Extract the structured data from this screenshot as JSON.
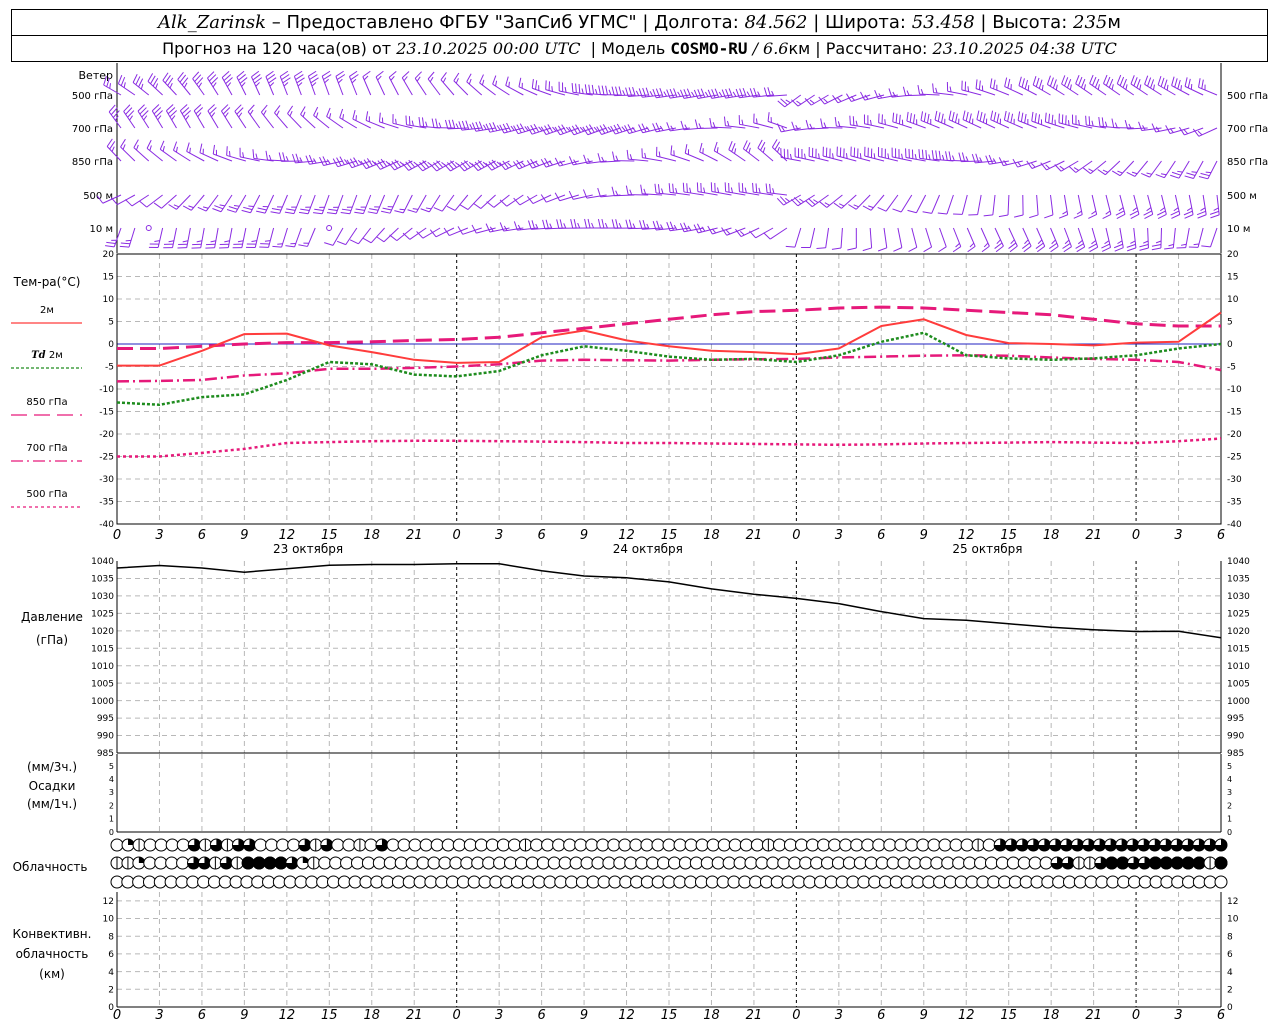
{
  "header": {
    "station": "Alk_Zarinsk",
    "sep": " – ",
    "provider": "Предоставлено ФГБУ \"ЗапСиб УГМС\"",
    "lon_label": "Долгота:",
    "lon": "84.562",
    "lat_label": "Широта:",
    "lat": "53.458",
    "alt_label": "Высота:",
    "alt": "235",
    "alt_unit": "м",
    "forecast_label": "Прогноз на 120 часа(ов) от",
    "forecast_from": "23.10.2025 00:00 UTC",
    "model_label": "Модель",
    "model": "COSMO-RU",
    "resolution": "/ 6.6",
    "res_unit": "км",
    "computed_label": "Рассчитано:",
    "computed": "23.10.2025 04:38 UTC"
  },
  "chart_data": [
    {
      "type": "wind_barbs",
      "title": "Ветер",
      "levels": [
        "500 гПа",
        "700 гПа",
        "850 гПа",
        "500 м",
        "10 м"
      ],
      "colors": {
        "barb": "#8a2be2",
        "calm": "#8a2be2"
      }
    },
    {
      "type": "line",
      "ylabel": "Тем-ра(°С)",
      "ylim": [
        -40,
        20
      ],
      "yticks": [
        -40,
        -35,
        -30,
        -25,
        -20,
        -15,
        -10,
        -5,
        0,
        5,
        10,
        15,
        20
      ],
      "x_hours": [
        0,
        3,
        6,
        9,
        12,
        15,
        18,
        21,
        24,
        27,
        30,
        33,
        36,
        39,
        42,
        45,
        48,
        51,
        54,
        57,
        60,
        63,
        66,
        69,
        72,
        75,
        78
      ],
      "series": [
        {
          "name": "2м",
          "color": "#ff3c3c",
          "dash": "solid",
          "values": [
            -4.8,
            -4.8,
            -1.5,
            2.2,
            2.3,
            -0.3,
            -1.8,
            -3.5,
            -4.2,
            -4.0,
            1.5,
            3.0,
            0.8,
            -0.5,
            -1.5,
            -1.8,
            -2.3,
            -1.0,
            4.0,
            5.5,
            2.0,
            0.2,
            0.0,
            -0.3,
            0.3,
            0.5,
            7.0
          ]
        },
        {
          "name": "Td  2м",
          "color": "#1e8c1e",
          "dash": "dot",
          "values": [
            -13.0,
            -13.5,
            -11.8,
            -11.2,
            -8.0,
            -4.0,
            -4.5,
            -6.8,
            -7.2,
            -6.0,
            -2.5,
            -0.5,
            -1.5,
            -2.8,
            -3.5,
            -3.3,
            -4.0,
            -2.5,
            0.5,
            2.5,
            -2.5,
            -3.2,
            -3.5,
            -3.2,
            -2.5,
            -1.0,
            0.0
          ]
        },
        {
          "name": "850 гПа",
          "color": "#e6197a",
          "dash": "long-dash",
          "values": [
            -1.0,
            -1.0,
            -0.5,
            0.0,
            0.3,
            0.3,
            0.5,
            0.8,
            1.0,
            1.5,
            2.5,
            3.5,
            4.5,
            5.5,
            6.5,
            7.2,
            7.5,
            8.0,
            8.2,
            8.0,
            7.5,
            7.0,
            6.5,
            5.5,
            4.5,
            4.0,
            4.0
          ]
        },
        {
          "name": "700 гПа",
          "color": "#e6197a",
          "dash": "dash-dot",
          "values": [
            -8.3,
            -8.2,
            -8.0,
            -7.0,
            -6.5,
            -5.5,
            -5.5,
            -5.3,
            -5.0,
            -4.5,
            -3.7,
            -3.5,
            -3.6,
            -3.7,
            -3.5,
            -3.4,
            -3.3,
            -3.0,
            -2.8,
            -2.6,
            -2.5,
            -2.6,
            -3.0,
            -3.3,
            -3.5,
            -4.0,
            -5.8
          ]
        },
        {
          "name": "500 гПа",
          "color": "#e6197a",
          "dash": "short-dot",
          "values": [
            -25.0,
            -25.0,
            -24.2,
            -23.3,
            -22.0,
            -21.8,
            -21.6,
            -21.5,
            -21.5,
            -21.6,
            -21.7,
            -21.8,
            -22.0,
            -22.0,
            -22.1,
            -22.2,
            -22.3,
            -22.4,
            -22.3,
            -22.1,
            -22.0,
            -21.9,
            -21.8,
            -21.9,
            -22.0,
            -21.6,
            -21.0
          ]
        }
      ],
      "x_tick_labels": [
        "0",
        "3",
        "6",
        "9",
        "12",
        "15",
        "18",
        "21",
        "0",
        "3",
        "6",
        "9",
        "12",
        "15",
        "18",
        "21",
        "0",
        "3",
        "6",
        "9",
        "12",
        "15",
        "18",
        "21",
        "0",
        "3",
        "6"
      ],
      "date_labels": [
        "23 октября",
        "24 октября",
        "25 октября"
      ]
    },
    {
      "type": "line",
      "ylabel": "Давление",
      "yunit": "(гПа)",
      "ylim": [
        985,
        1040
      ],
      "yticks": [
        985,
        990,
        995,
        1000,
        1005,
        1010,
        1015,
        1020,
        1025,
        1030,
        1035,
        1040
      ],
      "x_hours": [
        0,
        3,
        6,
        9,
        12,
        15,
        18,
        21,
        24,
        27,
        30,
        33,
        36,
        39,
        42,
        45,
        48,
        51,
        54,
        57,
        60,
        63,
        66,
        69,
        72,
        75,
        78
      ],
      "series": [
        {
          "name": "pressure",
          "color": "#000000",
          "values": [
            1038.0,
            1038.7,
            1038.0,
            1036.8,
            1037.8,
            1038.8,
            1039.0,
            1039.0,
            1039.2,
            1039.2,
            1037.2,
            1035.7,
            1035.2,
            1034.0,
            1032.0,
            1030.5,
            1029.3,
            1027.8,
            1025.5,
            1023.5,
            1023.0,
            1022.0,
            1021.0,
            1020.3,
            1019.8,
            1019.9,
            1018.0
          ]
        }
      ]
    },
    {
      "type": "bar",
      "ylabel": "Осадки",
      "yunit_top": "(мм/3ч.)",
      "yunit_bottom": "(мм/1ч.)",
      "ylim": [
        0,
        5
      ],
      "yticks": [
        0,
        1,
        2,
        3,
        4,
        5
      ],
      "values": []
    },
    {
      "type": "cloud_cover",
      "ylabel": "Облачность",
      "rows": [
        [
          0,
          2,
          1,
          0,
          0,
          0,
          0,
          3,
          1,
          3,
          1,
          3,
          3,
          0,
          0,
          0,
          0,
          3,
          1,
          3,
          0,
          0,
          1,
          0,
          3,
          0,
          0,
          0,
          0,
          0,
          0,
          0,
          0,
          0,
          0,
          0,
          0,
          1,
          0,
          0,
          0,
          0,
          0,
          0,
          0,
          0,
          0,
          0,
          0,
          0,
          0,
          0,
          0,
          0,
          0,
          0,
          0,
          0,
          0,
          1,
          0,
          0,
          0,
          0,
          0,
          0,
          0,
          0,
          0,
          0,
          0,
          0,
          0,
          0,
          0,
          0,
          0,
          0,
          1,
          0,
          3,
          3,
          3,
          3,
          3,
          3,
          3,
          3,
          3,
          3,
          3,
          3,
          3,
          3,
          3,
          3,
          3,
          3,
          3,
          3,
          3
        ],
        [
          1,
          1,
          2,
          0,
          0,
          0,
          0,
          3,
          3,
          1,
          3,
          1,
          4,
          4,
          4,
          4,
          3,
          2,
          1,
          0,
          0,
          0,
          0,
          0,
          0,
          0,
          0,
          0,
          0,
          0,
          0,
          0,
          0,
          0,
          0,
          0,
          0,
          0,
          0,
          0,
          0,
          0,
          0,
          0,
          0,
          0,
          0,
          0,
          0,
          0,
          0,
          0,
          0,
          0,
          0,
          0,
          0,
          0,
          0,
          0,
          0,
          0,
          0,
          0,
          0,
          0,
          0,
          0,
          0,
          0,
          0,
          0,
          0,
          0,
          0,
          0,
          0,
          0,
          0,
          0,
          0,
          0,
          0,
          0,
          0,
          0,
          3,
          3,
          1,
          1,
          3,
          4,
          4,
          3,
          3,
          4,
          4,
          4,
          4,
          4,
          1,
          4
        ],
        [
          0,
          0,
          0,
          0,
          0,
          0,
          0,
          0,
          0,
          0,
          0,
          0,
          0,
          0,
          0,
          0,
          0,
          0,
          0,
          0,
          0,
          0,
          0,
          0,
          0,
          0,
          0,
          0,
          0,
          0,
          0,
          0,
          0,
          0,
          0,
          0,
          0,
          0,
          0,
          0,
          0,
          0,
          0,
          0,
          0,
          0,
          0,
          0,
          0,
          0,
          0,
          0,
          0,
          0,
          0,
          0,
          0,
          0,
          0,
          0,
          0,
          0,
          0,
          0,
          0,
          0,
          0,
          0,
          0,
          0,
          0,
          0,
          0,
          0,
          0,
          0,
          0,
          0,
          0,
          0,
          0,
          0,
          0,
          0,
          0,
          0,
          0,
          0,
          0,
          0,
          0,
          0,
          0,
          0,
          0,
          0,
          0,
          0,
          0,
          0,
          0,
          0,
          0
        ]
      ]
    },
    {
      "type": "bar",
      "ylabel_lines": [
        "Конвективн.",
        "облачность",
        "(км)"
      ],
      "ylim": [
        0,
        13
      ],
      "yticks": [
        0,
        2,
        4,
        6,
        8,
        10,
        12
      ],
      "values": []
    }
  ]
}
